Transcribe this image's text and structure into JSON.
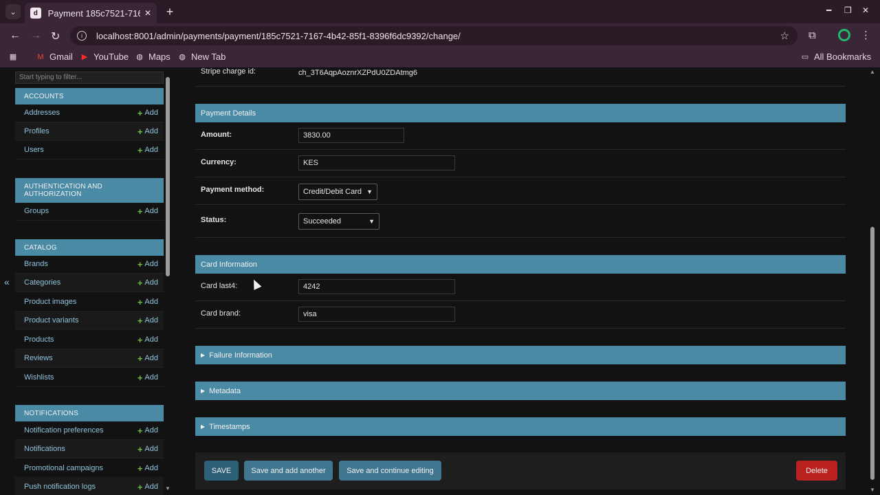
{
  "browser": {
    "tab_title": "Payment 185c7521-716",
    "url": "localhost:8001/admin/payments/payment/185c7521-7167-4b42-85f1-8396f6dc9392/change/",
    "bookmarks": [
      "Gmail",
      "YouTube",
      "Maps",
      "New Tab"
    ],
    "all_bookmarks": "All Bookmarks"
  },
  "sidebar": {
    "filter_placeholder": "Start typing to filter...",
    "add_label": "Add",
    "modules": [
      {
        "title": "ACCOUNTS",
        "models": [
          "Addresses",
          "Profiles",
          "Users"
        ]
      },
      {
        "title": "AUTHENTICATION AND AUTHORIZATION",
        "models": [
          "Groups"
        ]
      },
      {
        "title": "CATALOG",
        "models": [
          "Brands",
          "Categories",
          "Product images",
          "Product variants",
          "Products",
          "Reviews",
          "Wishlists"
        ]
      },
      {
        "title": "NOTIFICATIONS",
        "models": [
          "Notification preferences",
          "Notifications",
          "Promotional campaigns",
          "Push notification logs"
        ]
      }
    ]
  },
  "form": {
    "stripe_charge_label": "Stripe charge id:",
    "stripe_charge_value": "ch_3T6AqpAoznrXZPdU0ZDAtmg6",
    "payment_details_title": "Payment Details",
    "amount_label": "Amount:",
    "amount_value": "3830.00",
    "currency_label": "Currency:",
    "currency_value": "KES",
    "method_label": "Payment method:",
    "method_value": "Credit/Debit Card",
    "status_label": "Status:",
    "status_value": "Succeeded",
    "card_info_title": "Card Information",
    "card_last4_label": "Card last4:",
    "card_last4_value": "4242",
    "card_brand_label": "Card brand:",
    "card_brand_value": "visa",
    "failure_title": "Failure Information",
    "metadata_title": "Metadata",
    "timestamps_title": "Timestamps"
  },
  "actions": {
    "save": "SAVE",
    "save_add": "Save and add another",
    "save_continue": "Save and continue editing",
    "delete": "Delete"
  },
  "colors": {
    "module_header": "#4b8aa5",
    "link": "#8fc3de",
    "button": "#417690",
    "delete": "#ba2121"
  }
}
